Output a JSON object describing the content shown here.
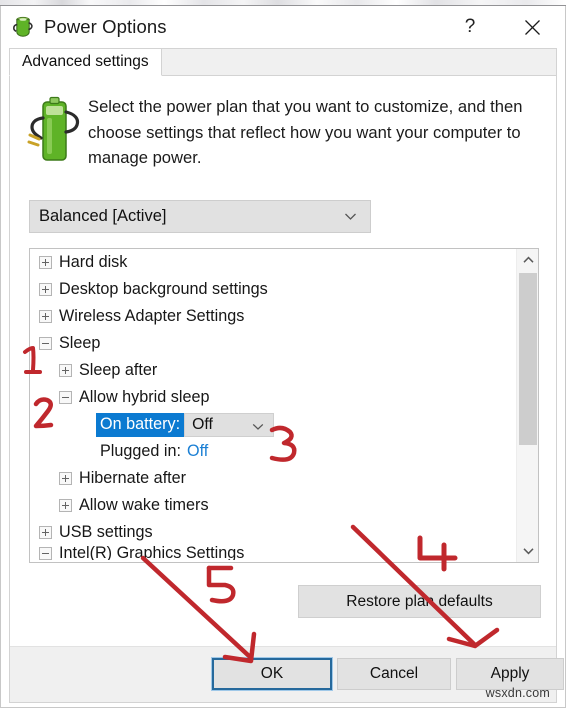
{
  "window": {
    "title": "Power Options",
    "app_icon": "power-plug-battery-icon",
    "help_label": "?",
    "close_label": "✕"
  },
  "tab": {
    "label": "Advanced settings"
  },
  "banner": {
    "icon": "battery-plug-icon",
    "text": "Select the power plan that you want to customize, and then choose settings that reflect how you want your computer to manage power."
  },
  "plan_select": {
    "value": "Balanced [Active]",
    "arrow_icon": "chevron-down-icon"
  },
  "tree": {
    "items": [
      {
        "label": "Hard disk",
        "level": 0,
        "state": "collapsed"
      },
      {
        "label": "Desktop background settings",
        "level": 0,
        "state": "collapsed"
      },
      {
        "label": "Wireless Adapter Settings",
        "level": 0,
        "state": "collapsed"
      },
      {
        "label": "Sleep",
        "level": 0,
        "state": "expanded"
      },
      {
        "label": "Sleep after",
        "level": 1,
        "state": "collapsed"
      },
      {
        "label": "Allow hybrid sleep",
        "level": 1,
        "state": "expanded"
      }
    ],
    "on_battery": {
      "label": "On battery:",
      "value": "Off",
      "arrow_icon": "chevron-down-icon",
      "selected": true
    },
    "plugged_in": {
      "label": "Plugged in:",
      "value": "Off"
    },
    "items_after": [
      {
        "label": "Hibernate after",
        "level": 1,
        "state": "collapsed"
      },
      {
        "label": "Allow wake timers",
        "level": 1,
        "state": "collapsed"
      },
      {
        "label": "USB settings",
        "level": 0,
        "state": "collapsed"
      }
    ],
    "partial_item": {
      "label": "Intel(R) Graphics Settings",
      "level": 0,
      "state": "expanded"
    },
    "scrollbar": {
      "up_icon": "chevron-up-icon",
      "down_icon": "chevron-down-icon"
    }
  },
  "buttons": {
    "restore_defaults": "Restore plan defaults",
    "ok": "OK",
    "cancel": "Cancel",
    "apply": "Apply"
  },
  "watermark": "wsxdn.com",
  "annotations": {
    "color": "#c0282d",
    "marks": [
      {
        "label": "1",
        "target": "Sleep tree node"
      },
      {
        "label": "2",
        "target": "Allow hybrid sleep tree node"
      },
      {
        "label": "3",
        "target": "On battery dropdown"
      },
      {
        "label": "4",
        "target": "Apply button"
      },
      {
        "label": "5",
        "target": "OK button"
      }
    ]
  },
  "colors": {
    "accent_blue": "#0b7ad1",
    "link_blue": "#1a7fd4",
    "focus_border": "#26699c",
    "annotation_red": "#c0282d",
    "window_bg": "#ffffff",
    "footer_bg": "#f0f0f0",
    "button_bg": "#e2e2e2"
  }
}
